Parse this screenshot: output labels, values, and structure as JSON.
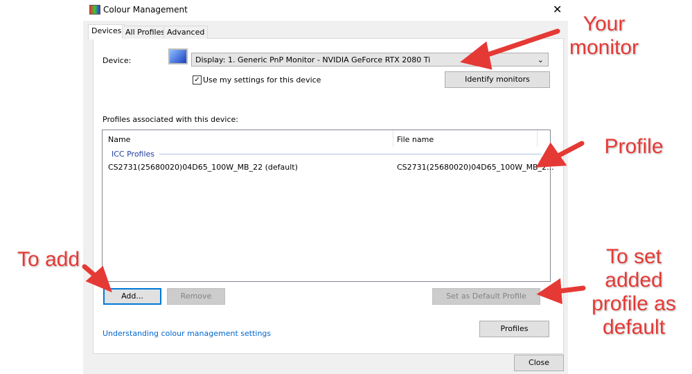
{
  "window": {
    "title": "Colour Management",
    "close_glyph": "✕"
  },
  "tabs": [
    {
      "label": "Devices",
      "active": true
    },
    {
      "label": "All Profiles"
    },
    {
      "label": "Advanced"
    }
  ],
  "device": {
    "label": "Device:",
    "selected": "Display: 1. Generic PnP Monitor - NVIDIA GeForce RTX 2080 Ti",
    "use_settings_label": "Use my settings for this device",
    "use_settings_checked": true,
    "identify_label": "Identify monitors"
  },
  "profiles": {
    "label": "Profiles associated with this device:",
    "columns": [
      "Name",
      "File name"
    ],
    "group": "ICC Profiles",
    "rows": [
      {
        "name": "CS2731(25680020)04D65_100W_MB_22 (default)",
        "file": "CS2731(25680020)04D65_100W_MB_2..."
      }
    ]
  },
  "buttons": {
    "add": "Add...",
    "remove": "Remove",
    "set_default": "Set as Default Profile",
    "profiles": "Profiles",
    "close": "Close"
  },
  "link": "Understanding colour management settings",
  "annotations": {
    "monitor": "Your monitor",
    "profile": "Profile",
    "add": "To add",
    "set_default": "To set added profile as default"
  },
  "colors": {
    "annotation": "#e53935",
    "link": "#0066cc",
    "group": "#1e3d9c"
  }
}
